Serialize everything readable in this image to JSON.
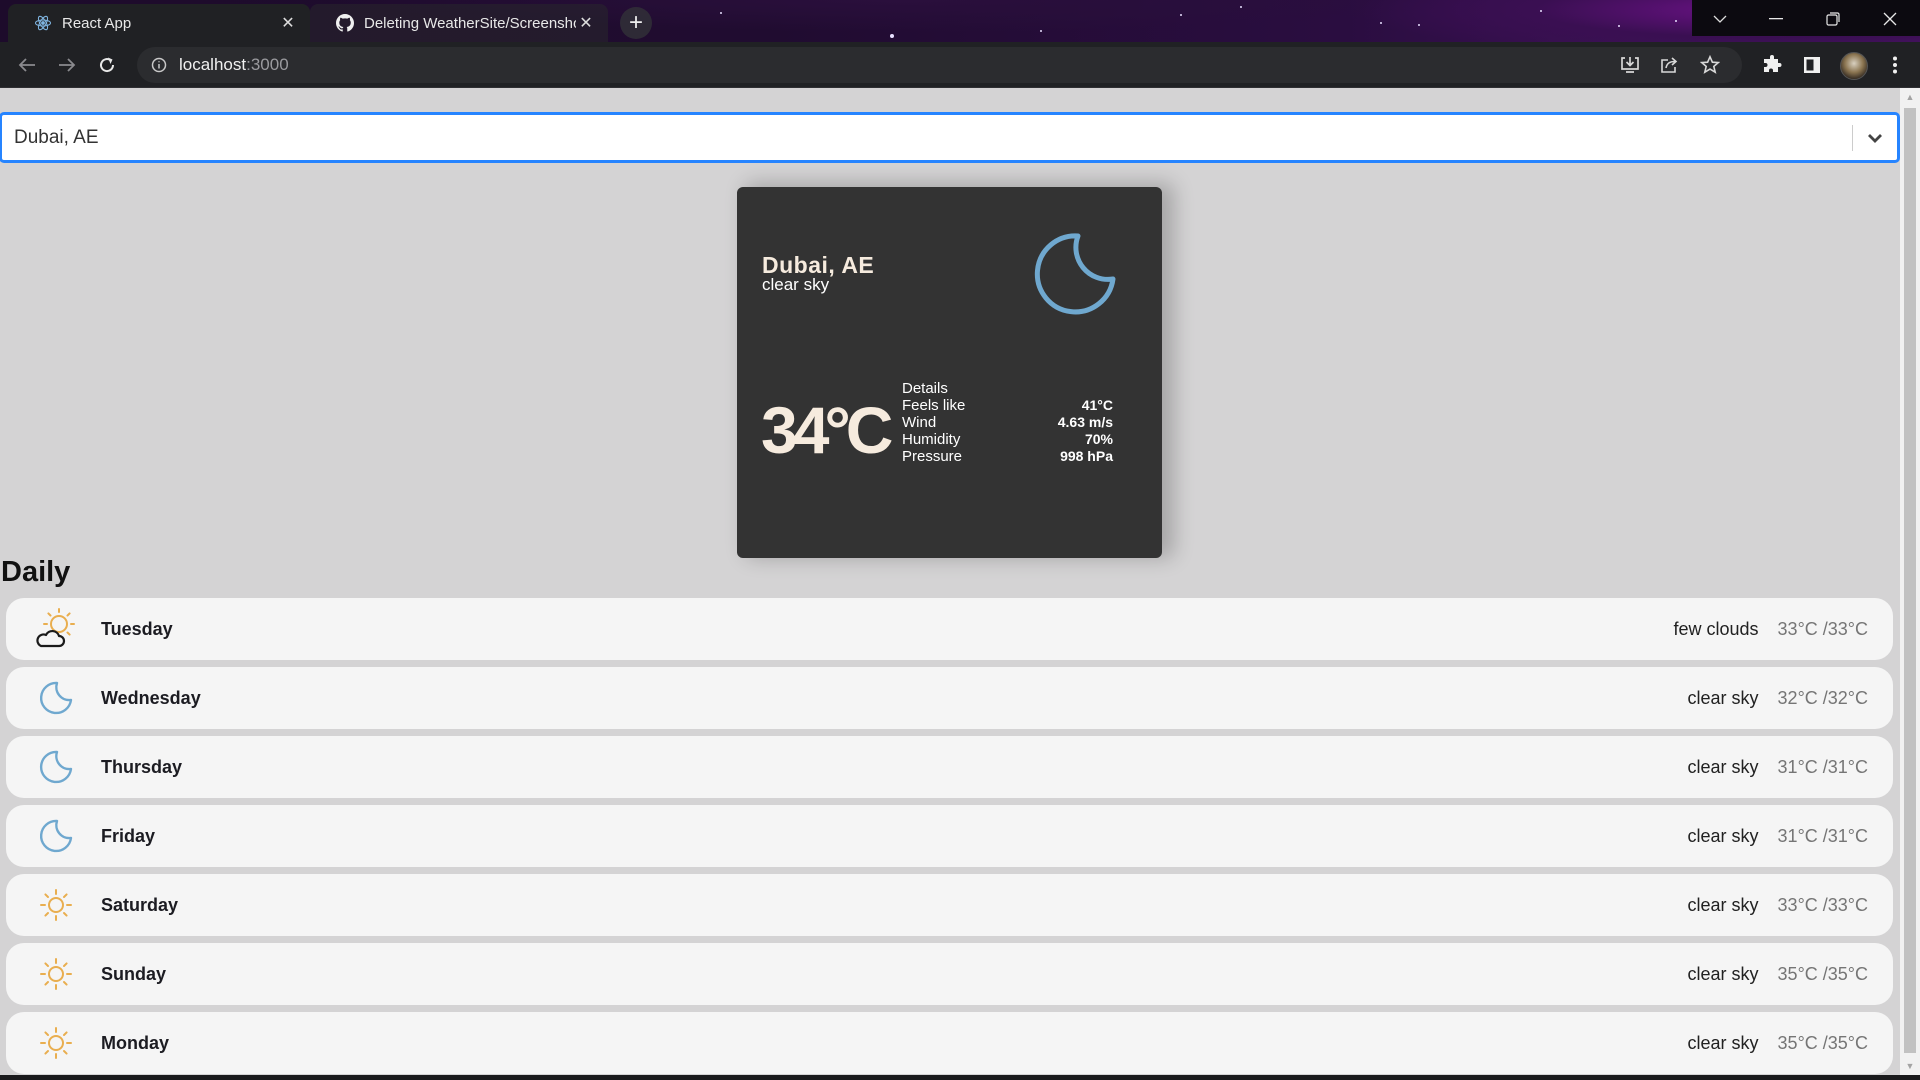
{
  "browser": {
    "tabs": [
      {
        "title": "React App",
        "icon": "react-icon",
        "active": true
      },
      {
        "title": "Deleting WeatherSite/Screenshot",
        "icon": "github-icon",
        "active": false
      }
    ],
    "new_tab_label": "+",
    "url": {
      "host": "localhost",
      "port": ":3000"
    },
    "toolbar_icons": [
      "back-icon",
      "forward-icon",
      "reload-icon",
      "info-icon",
      "install-icon",
      "share-icon",
      "star-icon",
      "extensions-icon",
      "side-panel-icon",
      "profile-avatar",
      "menu-icon"
    ],
    "window_controls": [
      "tab-search-icon",
      "minimize-icon",
      "restore-icon",
      "close-icon"
    ]
  },
  "search": {
    "value": "Dubai, AE"
  },
  "current": {
    "city": "Dubai, AE",
    "description": "clear sky",
    "icon": "moon-icon",
    "temperature": "34°C",
    "details_heading": "Details",
    "details": [
      {
        "label": "Feels like",
        "value": "41°C"
      },
      {
        "label": "Wind",
        "value": "4.63 m/s"
      },
      {
        "label": "Humidity",
        "value": "70%"
      },
      {
        "label": "Pressure",
        "value": "998 hPa"
      }
    ],
    "colors": {
      "card_bg": "#333333",
      "text": "#f6ebde",
      "moon": "#6fa8cf"
    }
  },
  "daily": {
    "title": "Daily",
    "days": [
      {
        "day": "Tuesday",
        "icon": "sun-cloud-icon",
        "description": "few clouds",
        "temp": "33°C /33°C"
      },
      {
        "day": "Wednesday",
        "icon": "moon-icon",
        "description": "clear sky",
        "temp": "32°C /32°C"
      },
      {
        "day": "Thursday",
        "icon": "moon-icon",
        "description": "clear sky",
        "temp": "31°C /31°C"
      },
      {
        "day": "Friday",
        "icon": "moon-icon",
        "description": "clear sky",
        "temp": "31°C /31°C"
      },
      {
        "day": "Saturday",
        "icon": "sun-icon",
        "description": "clear sky",
        "temp": "33°C /33°C"
      },
      {
        "day": "Sunday",
        "icon": "sun-icon",
        "description": "clear sky",
        "temp": "35°C /35°C"
      },
      {
        "day": "Monday",
        "icon": "sun-icon",
        "description": "clear sky",
        "temp": "35°C /35°C"
      }
    ],
    "colors": {
      "sun": "#e9ae4f",
      "moon": "#6fa8cf",
      "cloud": "#1a1a1a"
    }
  }
}
